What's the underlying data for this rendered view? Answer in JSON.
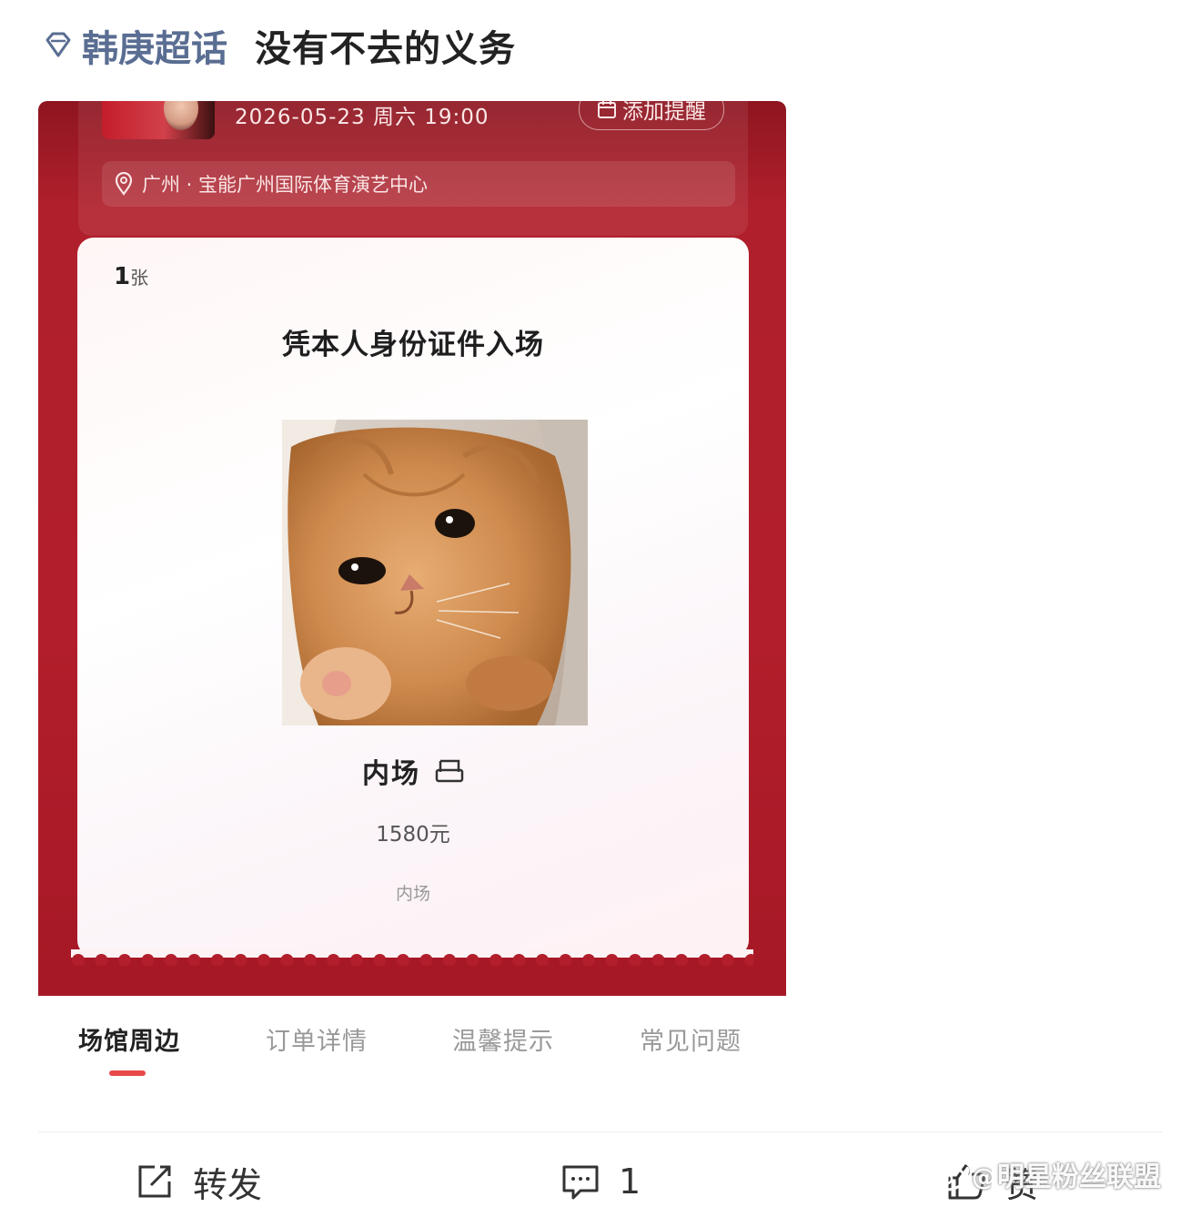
{
  "post": {
    "topic": "韩庚超话",
    "text": "没有不去的义务"
  },
  "event": {
    "datetime": "2026-05-23 周六 19:00",
    "remind_label": "添加提醒",
    "venue": "广州 · 宝能广州国际体育演艺中心"
  },
  "ticket": {
    "count": "1",
    "count_unit": "张",
    "entry_note": "凭本人身份证件入场",
    "zone": "内场",
    "price": "1580元",
    "zone_sub": "内场"
  },
  "tabs": [
    "场馆周边",
    "订单详情",
    "温馨提示",
    "常见问题"
  ],
  "actions": {
    "repost_label": "转发",
    "comment_count": "1",
    "like_label": "赞"
  },
  "watermark": "明星粉丝联盟",
  "colors": {
    "topic": "#5a6d92",
    "ticket_red": "#b21e2b",
    "tab_active_underline": "#e84a4a"
  }
}
